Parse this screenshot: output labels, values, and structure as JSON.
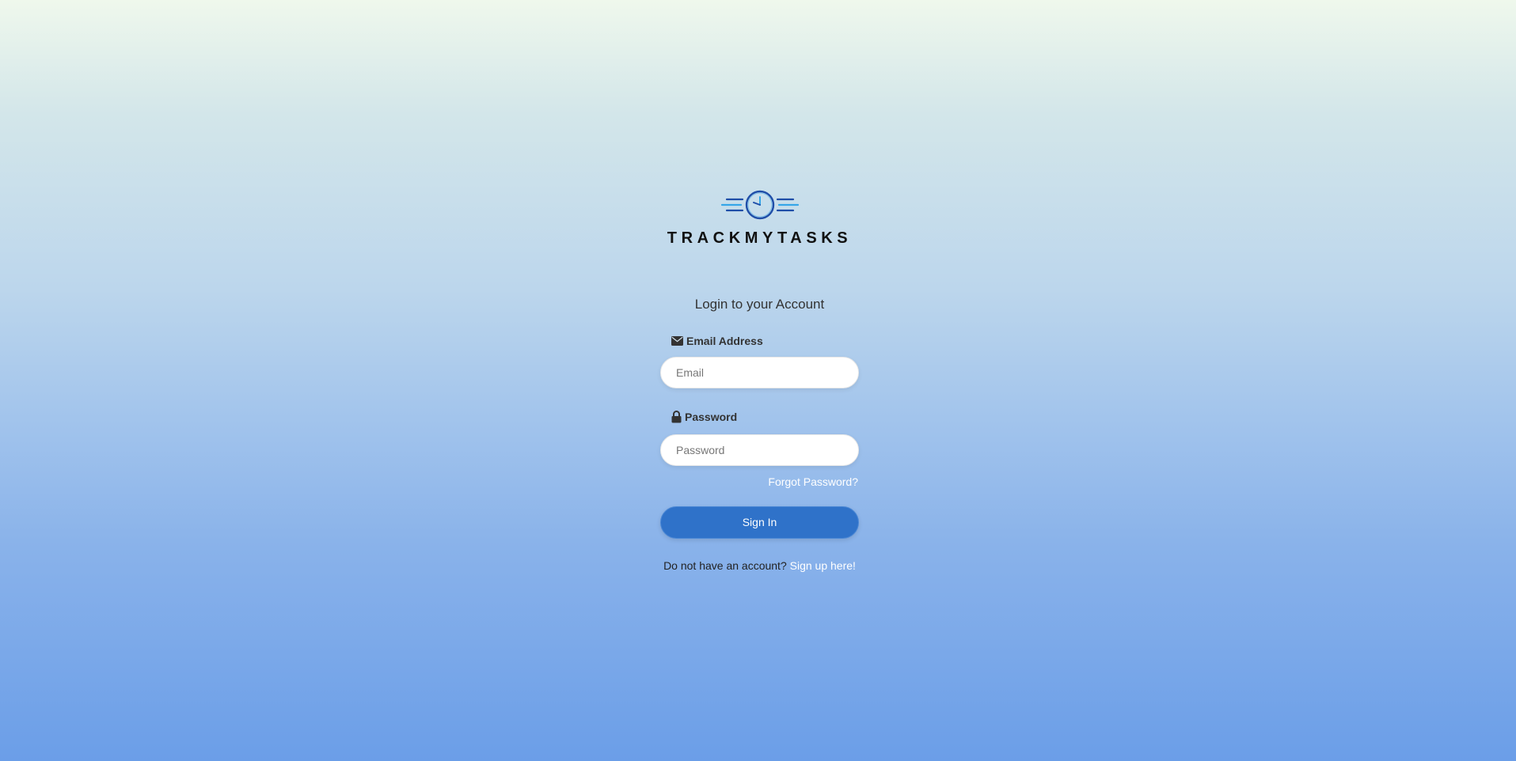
{
  "brand": {
    "name": "TRACKMYTASKS",
    "logo_icon": "clock-speed-icon",
    "colors": {
      "logo_dark_blue": "#1f4ea8",
      "logo_light_blue": "#35a6e8"
    }
  },
  "login": {
    "heading": "Login to your Account",
    "email": {
      "label": "Email Address",
      "icon": "envelope-icon",
      "placeholder": "Email",
      "value": ""
    },
    "password": {
      "label": "Password",
      "icon": "lock-icon",
      "placeholder": "Password",
      "value": ""
    },
    "forgot_password": "Forgot Password?",
    "sign_in_label": "Sign In",
    "sign_in_color": "#2f72c9",
    "signup_prompt": "Do not have an account?",
    "signup_link": "Sign up here!"
  }
}
